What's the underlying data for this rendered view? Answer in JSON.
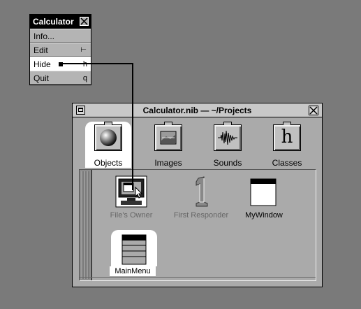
{
  "menu": {
    "title": "Calculator",
    "items": [
      {
        "label": "Info...",
        "key": ""
      },
      {
        "label": "Edit",
        "key": "⊢"
      },
      {
        "label": "Hide",
        "key": "h"
      },
      {
        "label": "Quit",
        "key": "q"
      }
    ],
    "active_item": "Hide"
  },
  "window": {
    "title": "Calculator.nib  —  ~/Projects",
    "tabs": [
      {
        "label": "Objects",
        "icon": "sphere-icon",
        "selected": true
      },
      {
        "label": "Images",
        "icon": "image-icon",
        "selected": false
      },
      {
        "label": "Sounds",
        "icon": "waveform-icon",
        "selected": false
      },
      {
        "label": "Classes",
        "icon": "h-class-icon",
        "selected": false
      }
    ],
    "objects": [
      {
        "label": "File's Owner",
        "icon": "computer-icon",
        "state": "dim"
      },
      {
        "label": "First Responder",
        "icon": "number-one-icon",
        "state": "dim"
      },
      {
        "label": "MyWindow",
        "icon": "window-icon",
        "state": "normal"
      },
      {
        "label": "MainMenu",
        "icon": "menu-icon",
        "state": "selected"
      }
    ]
  },
  "colors": {
    "desktop": "#7a7a7a",
    "panel": "#aaaaaa",
    "highlight": "#ffffff",
    "title_black": "#000000"
  }
}
